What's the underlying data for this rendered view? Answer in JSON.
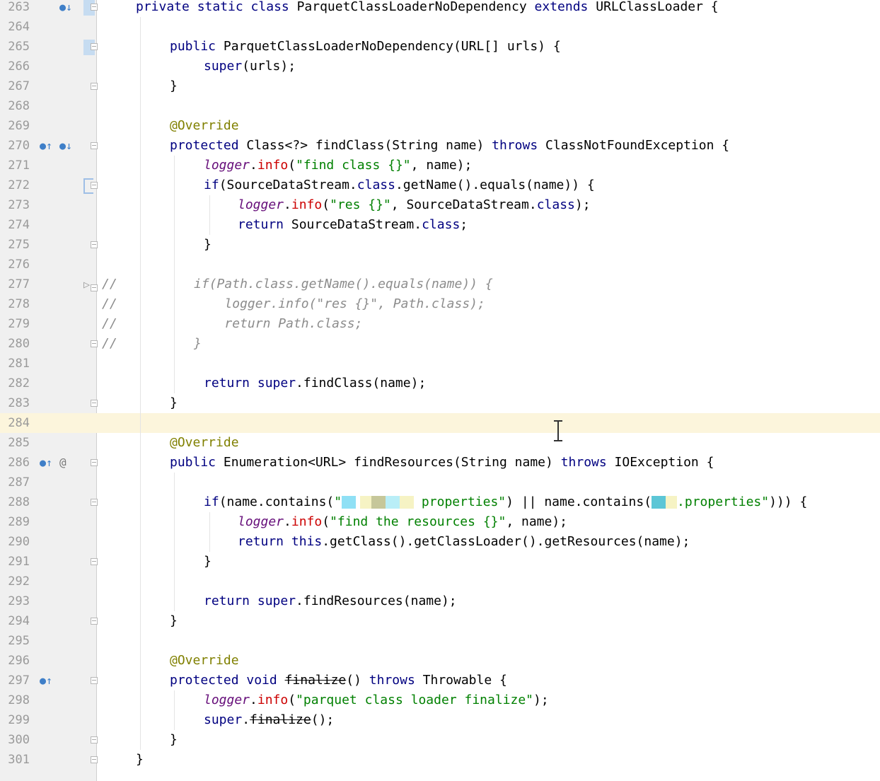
{
  "editor": {
    "current_line": 284,
    "lines": [
      {
        "n": "263",
        "indent": 0,
        "parts": [
          [
            "kw",
            "private static class "
          ],
          [
            "",
            "ParquetClassLoaderNoDependency "
          ],
          [
            "kw",
            "extends "
          ],
          [
            "",
            "URLClassLoader {"
          ]
        ],
        "marks": [
          "override-down"
        ],
        "fold": "open",
        "block": "filled"
      },
      {
        "n": "264",
        "indent": 0,
        "parts": []
      },
      {
        "n": "265",
        "indent": 1,
        "parts": [
          [
            "kw",
            "public "
          ],
          [
            "",
            "ParquetClassLoaderNoDependency(URL[] urls) {"
          ]
        ],
        "fold": "open",
        "block": "filled"
      },
      {
        "n": "266",
        "indent": 2,
        "parts": [
          [
            "kw",
            "super"
          ],
          [
            "",
            "(urls);"
          ]
        ]
      },
      {
        "n": "267",
        "indent": 1,
        "parts": [
          [
            "",
            "}"
          ]
        ],
        "fold": "close"
      },
      {
        "n": "268",
        "indent": 0,
        "parts": []
      },
      {
        "n": "269",
        "indent": 1,
        "parts": [
          [
            "ann",
            "@Override"
          ]
        ]
      },
      {
        "n": "270",
        "indent": 1,
        "parts": [
          [
            "kw",
            "protected "
          ],
          [
            "",
            "Class<?> findClass(String name) "
          ],
          [
            "kw",
            "throws "
          ],
          [
            "",
            "ClassNotFoundException {"
          ]
        ],
        "marks": [
          "override-up",
          "override-down"
        ],
        "fold": "open"
      },
      {
        "n": "271",
        "indent": 2,
        "parts": [
          [
            "fld",
            "logger"
          ],
          [
            "",
            "."
          ],
          [
            "meth",
            "info"
          ],
          [
            "",
            "("
          ],
          [
            "str",
            "\"find class {}\""
          ],
          [
            "",
            ", name);"
          ]
        ]
      },
      {
        "n": "272",
        "indent": 2,
        "parts": [
          [
            "kw",
            "if"
          ],
          [
            "",
            "(SourceDataStream."
          ],
          [
            "kw",
            "class"
          ],
          [
            "",
            ".getName().equals(name)) {"
          ]
        ],
        "fold": "open",
        "block": "outline"
      },
      {
        "n": "273",
        "indent": 3,
        "parts": [
          [
            "fld",
            "logger"
          ],
          [
            "",
            "."
          ],
          [
            "meth",
            "info"
          ],
          [
            "",
            "("
          ],
          [
            "str",
            "\"res {}\""
          ],
          [
            "",
            ", SourceDataStream."
          ],
          [
            "kw",
            "class"
          ],
          [
            "",
            ");"
          ]
        ]
      },
      {
        "n": "274",
        "indent": 3,
        "parts": [
          [
            "kw",
            "return "
          ],
          [
            "",
            "SourceDataStream."
          ],
          [
            "kw",
            "class"
          ],
          [
            "",
            ";"
          ]
        ]
      },
      {
        "n": "275",
        "indent": 2,
        "parts": [
          [
            "",
            "}"
          ]
        ],
        "fold": "close"
      },
      {
        "n": "276",
        "indent": 0,
        "parts": []
      },
      {
        "n": "277",
        "indent": 0,
        "parts": [
          [
            "cmt",
            "//          if(Path.class.getName().equals(name)) {"
          ]
        ],
        "fold": "tri"
      },
      {
        "n": "278",
        "indent": 0,
        "parts": [
          [
            "cmt",
            "//              logger.info(\"res {}\", Path.class);"
          ]
        ]
      },
      {
        "n": "279",
        "indent": 0,
        "parts": [
          [
            "cmt",
            "//              return Path.class;"
          ]
        ]
      },
      {
        "n": "280",
        "indent": 0,
        "parts": [
          [
            "cmt",
            "//          }"
          ]
        ],
        "fold": "close"
      },
      {
        "n": "281",
        "indent": 0,
        "parts": []
      },
      {
        "n": "282",
        "indent": 2,
        "parts": [
          [
            "kw",
            "return super"
          ],
          [
            "",
            ".findClass(name);"
          ]
        ]
      },
      {
        "n": "283",
        "indent": 1,
        "parts": [
          [
            "",
            "}"
          ]
        ],
        "fold": "close"
      },
      {
        "n": "284",
        "indent": 0,
        "parts": []
      },
      {
        "n": "285",
        "indent": 1,
        "parts": [
          [
            "ann",
            "@Override"
          ]
        ]
      },
      {
        "n": "286",
        "indent": 1,
        "parts": [
          [
            "kw",
            "public "
          ],
          [
            "",
            "Enumeration<URL> findResources(String name) "
          ],
          [
            "kw",
            "throws "
          ],
          [
            "",
            "IOException {"
          ]
        ],
        "marks": [
          "override-up",
          "at"
        ],
        "fold": "open"
      },
      {
        "n": "287",
        "indent": 0,
        "parts": []
      },
      {
        "n": "288",
        "indent": 2,
        "parts": [
          [
            "kw",
            "if"
          ],
          [
            "",
            "(name.contains("
          ],
          [
            "str",
            "\""
          ],
          [
            "pix",
            "#8fe0f5:20,#fff:6,#f6f3c4:16,#c6c79a:20,#b9eef7:20,#f6f3c4:20"
          ],
          [
            "str",
            " properties\""
          ],
          [
            "",
            ") || name.contains("
          ],
          [
            "pix",
            "#5cc6d6:20,#f6f3c4:16"
          ],
          [
            "str",
            ".properties\""
          ],
          [
            "",
            "))) {"
          ]
        ],
        "fold": "open"
      },
      {
        "n": "289",
        "indent": 3,
        "parts": [
          [
            "fld",
            "logger"
          ],
          [
            "",
            "."
          ],
          [
            "meth",
            "info"
          ],
          [
            "",
            "("
          ],
          [
            "str",
            "\"find the resources {}\""
          ],
          [
            "",
            ", name);"
          ]
        ]
      },
      {
        "n": "290",
        "indent": 3,
        "parts": [
          [
            "kw",
            "return this"
          ],
          [
            "",
            ".getClass().getClassLoader().getResources(name);"
          ]
        ]
      },
      {
        "n": "291",
        "indent": 2,
        "parts": [
          [
            "",
            "}"
          ]
        ],
        "fold": "close"
      },
      {
        "n": "292",
        "indent": 0,
        "parts": []
      },
      {
        "n": "293",
        "indent": 2,
        "parts": [
          [
            "kw",
            "return super"
          ],
          [
            "",
            ".findResources(name);"
          ]
        ]
      },
      {
        "n": "294",
        "indent": 1,
        "parts": [
          [
            "",
            "}"
          ]
        ],
        "fold": "close"
      },
      {
        "n": "295",
        "indent": 0,
        "parts": []
      },
      {
        "n": "296",
        "indent": 1,
        "parts": [
          [
            "ann",
            "@Override"
          ]
        ]
      },
      {
        "n": "297",
        "indent": 1,
        "parts": [
          [
            "kw",
            "protected void "
          ],
          [
            "strike",
            "finalize"
          ],
          [
            "",
            "() "
          ],
          [
            "kw",
            "throws "
          ],
          [
            "",
            "Throwable {"
          ]
        ],
        "marks": [
          "override-up"
        ],
        "fold": "open"
      },
      {
        "n": "298",
        "indent": 2,
        "parts": [
          [
            "fld",
            "logger"
          ],
          [
            "",
            "."
          ],
          [
            "meth",
            "info"
          ],
          [
            "",
            "("
          ],
          [
            "str",
            "\"parquet class loader finalize\""
          ],
          [
            "",
            ");"
          ]
        ]
      },
      {
        "n": "299",
        "indent": 2,
        "parts": [
          [
            "kw",
            "super"
          ],
          [
            "",
            "."
          ],
          [
            "strike",
            "finalize"
          ],
          [
            "",
            "();"
          ]
        ]
      },
      {
        "n": "300",
        "indent": 1,
        "parts": [
          [
            "",
            "}"
          ]
        ],
        "fold": "close"
      },
      {
        "n": "301",
        "indent": 0,
        "parts": [
          [
            "",
            "}"
          ]
        ],
        "fold": "close"
      }
    ]
  },
  "icons": {
    "override-up": "override-up-icon",
    "override-down": "override-down-icon",
    "at": "annotation-at-icon"
  },
  "colors": {
    "keyword": "#000080",
    "string": "#008000",
    "annotation": "#808000",
    "field": "#660e7a",
    "method_call": "#cc0000",
    "comment": "#8c8c8c",
    "current_line_bg": "#fcf5dc"
  }
}
